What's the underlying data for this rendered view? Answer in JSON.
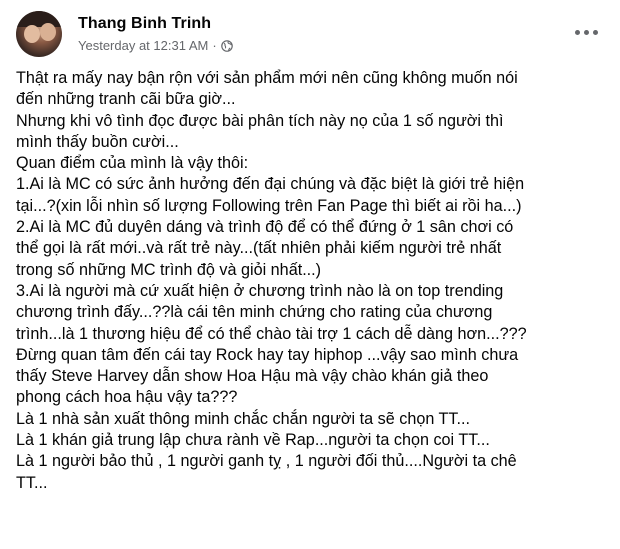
{
  "post": {
    "author": "Thang Binh Trinh",
    "timestamp": "Yesterday at 12:31 AM",
    "separator": "·",
    "privacy_icon": "globe-icon",
    "more_icon": "more-horizontal-icon",
    "lines": [
      "Thật ra mấy nay bận rộn với sản phẩm mới nên cũng không muốn nói",
      "đến những tranh cãi bữa giờ...",
      "Nhưng khi vô tình đọc được bài phân tích này nọ của 1 số người thì",
      "mình thấy buồn cười...",
      "Quan điểm của mình là vậy thôi:",
      "1.Ai là MC có sức ảnh hưởng đến đại chúng và đặc biệt là giới trẻ hiện",
      "tại...?(xin lỗi nhìn số lượng Following trên Fan Page thì biết ai rồi ha...)",
      "2.Ai là MC đủ duyên dáng và trình độ để có thể đứng ở 1 sân chơi có",
      "thể gọi là rất mới..và rất trẻ này...(tất nhiên phải kiếm người trẻ nhất",
      "trong số những MC trình độ và giỏi nhất...)",
      "3.Ai là người mà cứ xuất hiện ở chương trình nào là on top trending",
      "chương trình đấy...??là cái tên minh chứng cho rating của chương",
      "trình...là 1 thương hiệu để có thể chào tài trợ 1 cách dễ dàng hơn...???",
      "Đừng quan tâm đến cái tay Rock hay tay hiphop ...vậy sao mình chưa",
      "thấy Steve Harvey dẫn show Hoa Hậu mà vậy chào khán giả theo",
      "phong cách hoa hậu vậy ta???",
      "Là 1 nhà sản xuất thông minh chắc chắn người ta sẽ chọn TT...",
      "Là 1 khán giả trung lập chưa rành về Rap...người ta chọn coi TT...",
      "Là 1 người bảo thủ , 1 người ganh tỵ , 1 người đối thủ....Người ta chê",
      "TT..."
    ]
  },
  "colors": {
    "text": "#050505",
    "secondary": "#65676b",
    "background": "#ffffff"
  }
}
